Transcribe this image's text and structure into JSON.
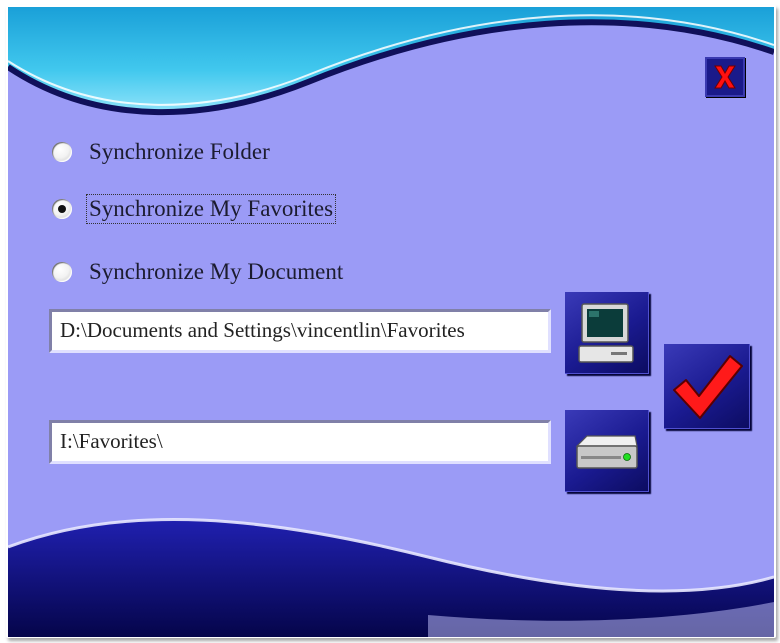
{
  "window": {
    "colors": {
      "background": "#9b9bf6",
      "top_wave_sky": "#1aa7dc",
      "bottom_wave": "#0a0a7a",
      "accent_red": "#ff0000"
    }
  },
  "close_button": {
    "icon": "close-x-icon"
  },
  "options": [
    {
      "label": "Synchronize Folder",
      "checked": false
    },
    {
      "label": "Synchronize My Favorites",
      "checked": true
    },
    {
      "label": "Synchronize My Document",
      "checked": false
    }
  ],
  "source_path": {
    "value": "D:\\Documents and Settings\\vincentlin\\Favorites"
  },
  "target_path": {
    "value": "I:\\Favorites\\"
  },
  "buttons": {
    "source_browse": {
      "icon": "computer-icon"
    },
    "target_browse": {
      "icon": "drive-icon"
    },
    "confirm": {
      "icon": "checkmark-icon"
    }
  }
}
